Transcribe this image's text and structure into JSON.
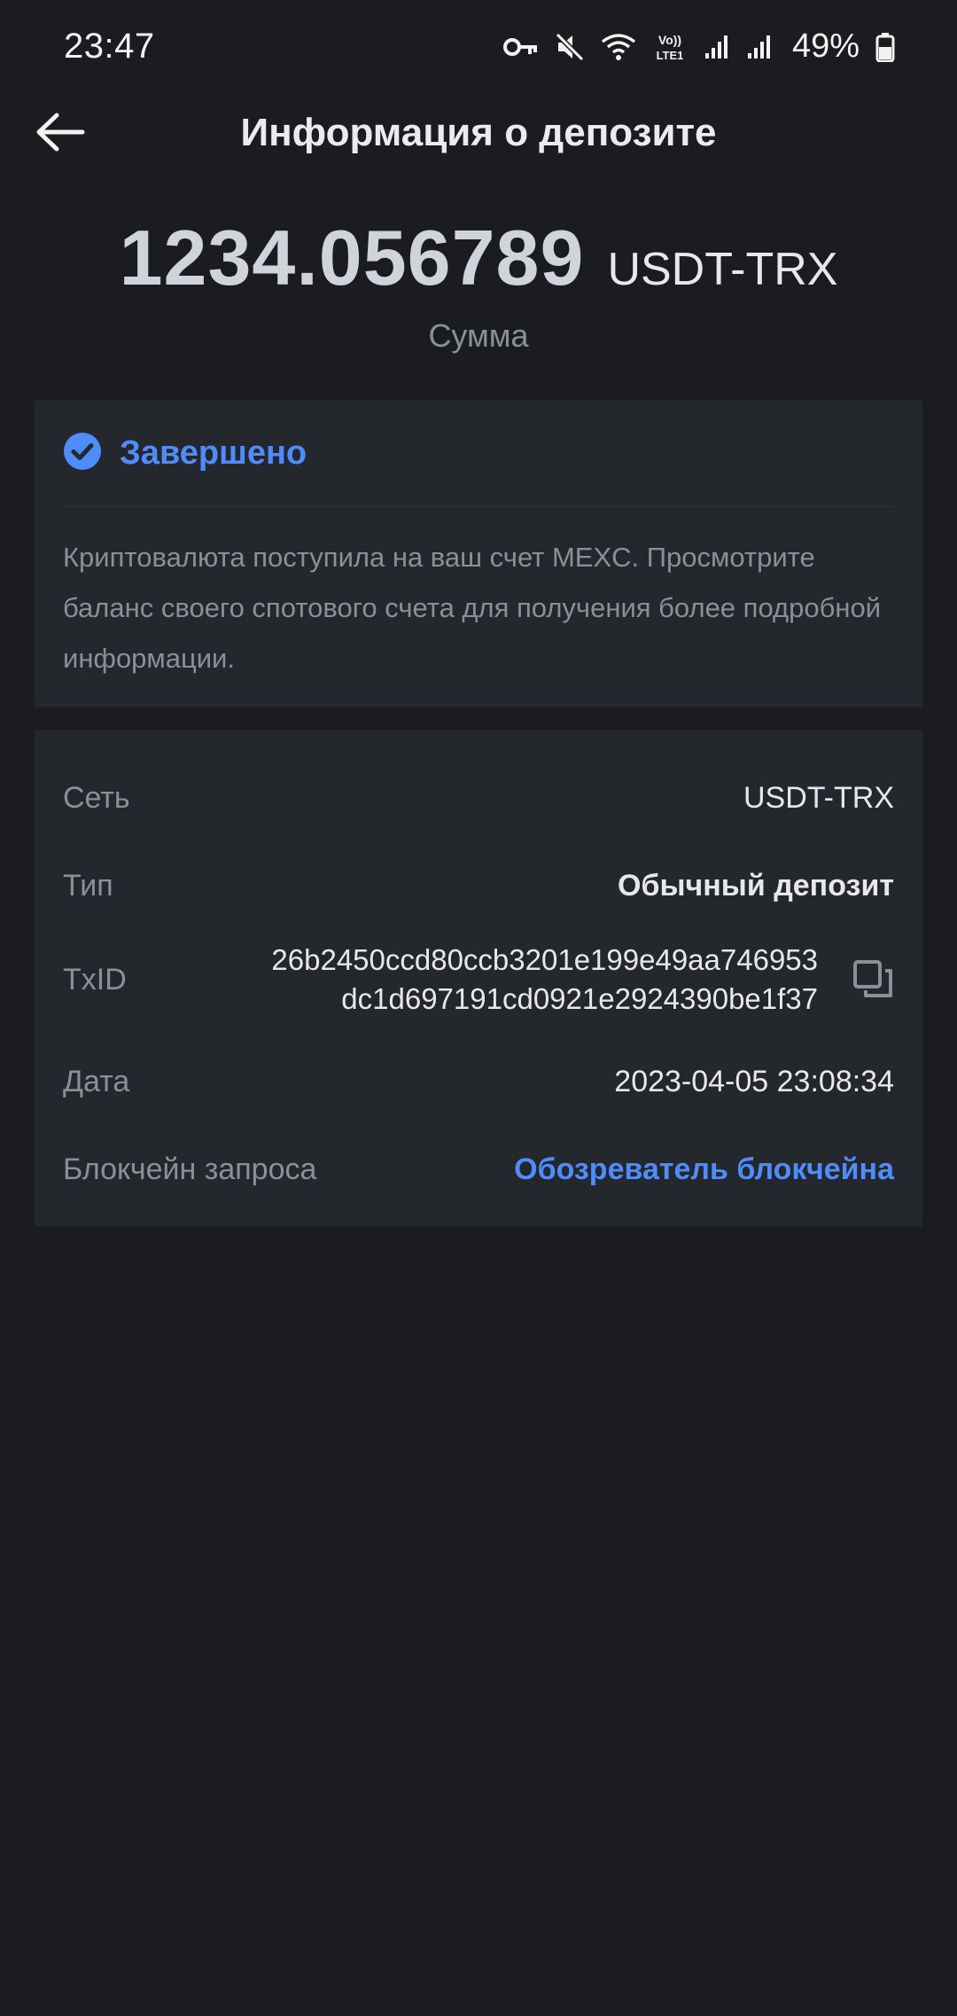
{
  "status_bar": {
    "time": "23:47",
    "battery": "49%",
    "icons": [
      "key-icon",
      "mute-icon",
      "wifi-icon",
      "volte-icon",
      "signal-icon",
      "signal-icon-2",
      "battery-icon"
    ],
    "volte_text": "Vo))\nLTE1"
  },
  "header": {
    "title": "Информация о депозите",
    "back_icon": "arrow-left-icon"
  },
  "amount": {
    "value": "1234.056789",
    "currency": "USDT-TRX",
    "label": "Сумма"
  },
  "status": {
    "icon": "check-circle-icon",
    "title": "Завершено",
    "description": "Криптовалюта поступила на ваш счет MEXC. Просмотрите баланс своего спотового счета для получения более подробной информации.",
    "color": "#4e8cff"
  },
  "details": {
    "network": {
      "label": "Сеть",
      "value": "USDT-TRX"
    },
    "type": {
      "label": "Тип",
      "value": "Обычный депозит"
    },
    "txid": {
      "label": "TxID",
      "line1": "26b2450ccd80ccb3201e199e49aa746953",
      "line2": "dc1d697191cd0921e2924390be1f37",
      "copy_icon": "copy-icon"
    },
    "date": {
      "label": "Дата",
      "value": "2023-04-05 23:08:34"
    },
    "explorer": {
      "label": "Блокчейн запроса",
      "value": "Обозреватель блокчейна"
    }
  },
  "colors": {
    "background": "#1a1c1f",
    "card": "#24272c",
    "accent": "#4e8cff",
    "muted_text": "#8a909a"
  }
}
